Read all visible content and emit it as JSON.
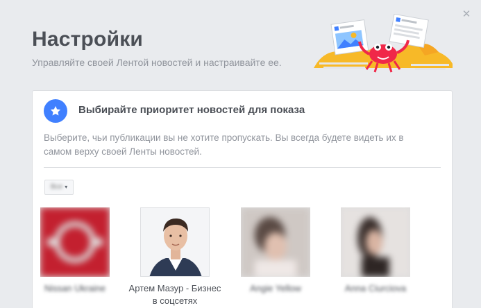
{
  "header": {
    "title": "Настройки",
    "subtitle": "Управляйте своей Лентой новостей и настраивайте ее."
  },
  "card": {
    "title": "Выбирайте приоритет новостей для показа",
    "description": "Выберите, чьи публикации вы не хотите пропускать. Вы всегда будете видеть их в самом верху своей Ленты новостей.",
    "filter_label": "Все"
  },
  "people": [
    {
      "name": "Nissan Ukraine",
      "blurred": true
    },
    {
      "name": "Артем Мазур - Бизнес в соцсетях",
      "blurred": false
    },
    {
      "name": "Angie Yellow",
      "blurred": true
    },
    {
      "name": "Anna Ciurciova",
      "blurred": true
    }
  ],
  "icons": {
    "close": "close-icon",
    "star": "star-icon",
    "filter_caret": "chevron-down-icon"
  },
  "colors": {
    "background": "#e9ebee",
    "accent": "#4080ff",
    "text_muted": "#90949c"
  }
}
